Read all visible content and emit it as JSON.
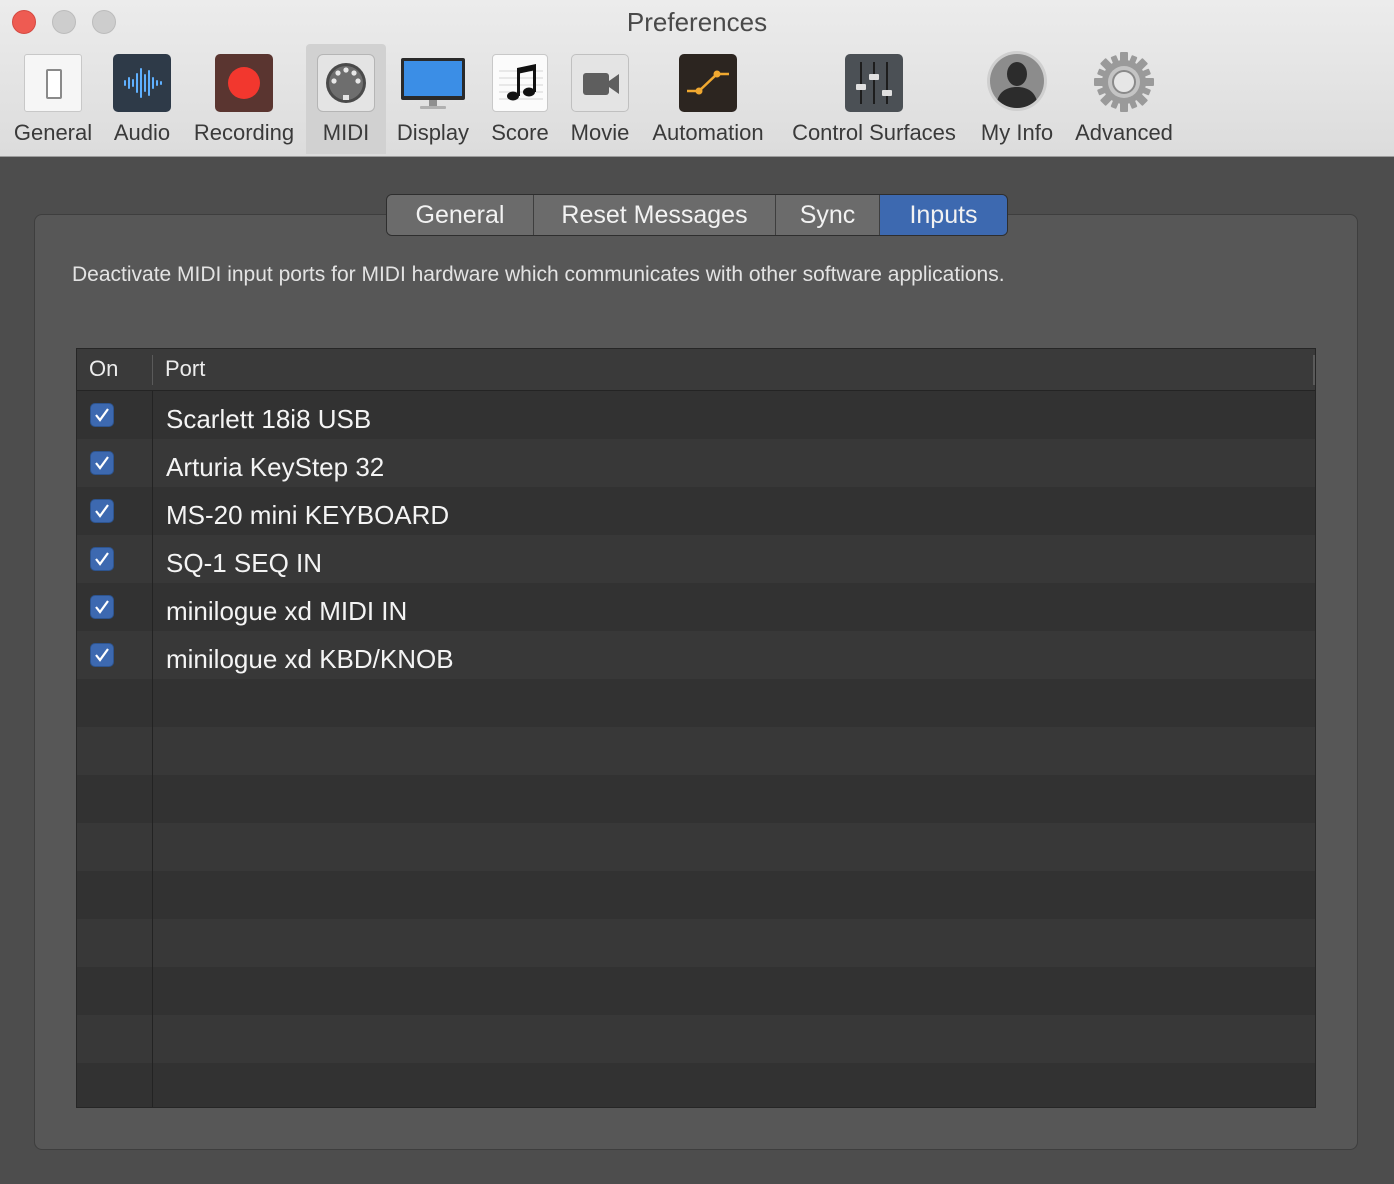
{
  "window": {
    "title": "Preferences"
  },
  "toolbar": {
    "items": [
      {
        "label": "General",
        "icon": "general-switch-icon"
      },
      {
        "label": "Audio",
        "icon": "audio-waveform-icon"
      },
      {
        "label": "Recording",
        "icon": "record-icon"
      },
      {
        "label": "MIDI",
        "icon": "midi-connector-icon",
        "selected": true
      },
      {
        "label": "Display",
        "icon": "display-monitor-icon"
      },
      {
        "label": "Score",
        "icon": "music-note-icon"
      },
      {
        "label": "Movie",
        "icon": "movie-camera-icon"
      },
      {
        "label": "Automation",
        "icon": "automation-curve-icon"
      },
      {
        "label": "Control Surfaces",
        "icon": "faders-icon"
      },
      {
        "label": "My Info",
        "icon": "user-silhouette-icon"
      },
      {
        "label": "Advanced",
        "icon": "gear-icon"
      }
    ]
  },
  "tabs": [
    {
      "label": "General"
    },
    {
      "label": "Reset Messages"
    },
    {
      "label": "Sync"
    },
    {
      "label": "Inputs",
      "active": true
    }
  ],
  "description": "Deactivate MIDI input ports for MIDI hardware which communicates with other software applications.",
  "table": {
    "columns": {
      "on": "On",
      "port": "Port"
    },
    "rows": [
      {
        "on": true,
        "port": "Scarlett 18i8 USB"
      },
      {
        "on": true,
        "port": "Arturia KeyStep 32"
      },
      {
        "on": true,
        "port": "MS-20 mini KEYBOARD"
      },
      {
        "on": true,
        "port": "SQ-1 SEQ IN"
      },
      {
        "on": true,
        "port": "minilogue xd MIDI IN"
      },
      {
        "on": true,
        "port": "minilogue xd KBD/KNOB"
      }
    ]
  },
  "colors": {
    "accent": "#3d69b0",
    "panel": "#575757",
    "table_background": "#323232"
  }
}
